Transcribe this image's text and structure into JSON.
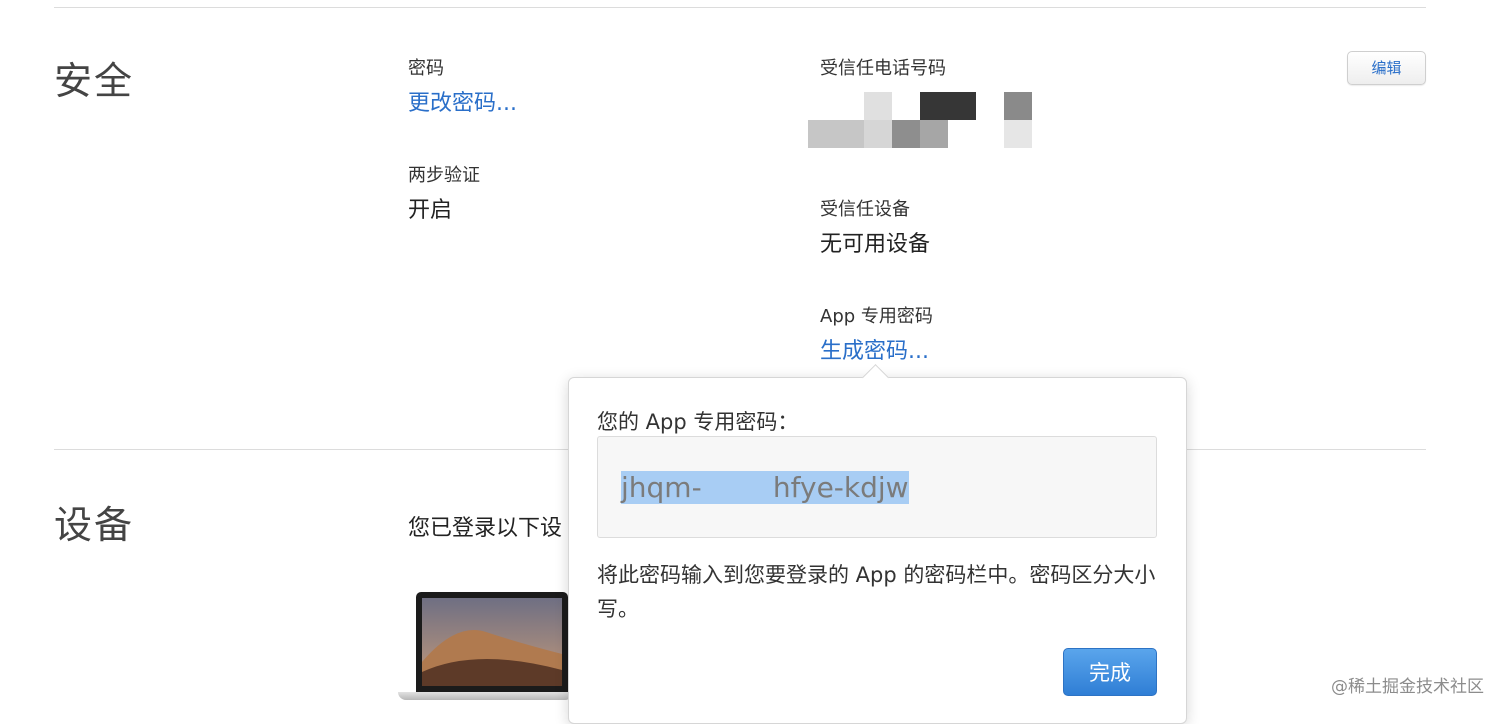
{
  "security": {
    "title": "安全",
    "password": {
      "label": "密码",
      "link": "更改密码..."
    },
    "two_step": {
      "label": "两步验证",
      "value": "开启"
    },
    "trusted_phone": {
      "label": "受信任电话号码"
    },
    "trusted_devices": {
      "label": "受信任设备",
      "value": "无可用设备"
    },
    "app_password": {
      "label": "App 专用密码",
      "link": "生成密码..."
    },
    "edit_label": "编辑"
  },
  "devices": {
    "title": "设备",
    "intro": "您已登录以下设"
  },
  "popover": {
    "title": "您的 App 专用密码：",
    "password_part1": "jhqm-",
    "password_gap": "        ",
    "password_part2": "hfye-kdjw",
    "description": "将此密码输入到您要登录的 App 的密码栏中。密码区分大小写。",
    "done_label": "完成"
  },
  "watermark": "@稀土掘金技术社区",
  "colors": {
    "link": "#2a6fc9",
    "done_button": "#3a87dc",
    "selection": "#a8cdf4"
  }
}
